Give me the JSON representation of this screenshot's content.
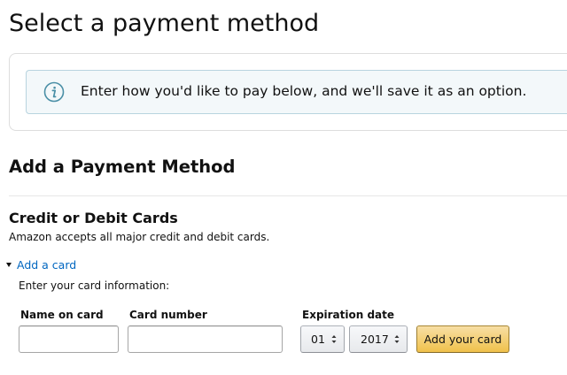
{
  "page": {
    "title": "Select a payment method"
  },
  "alert": {
    "icon": "info-icon",
    "text": "Enter how you'd like to pay below, and we'll save it as an option."
  },
  "section": {
    "heading": "Add a Payment Method"
  },
  "cards": {
    "heading": "Credit or Debit Cards",
    "description": "Amazon accepts all major credit and debit cards.",
    "add_card_label": "Add a card",
    "enter_info": "Enter your card information:"
  },
  "form": {
    "name_label": "Name on card",
    "name_value": "",
    "number_label": "Card number",
    "number_value": "",
    "expiration_label": "Expiration date",
    "month_selected": "01",
    "year_selected": "2017",
    "submit_label": "Add your card"
  },
  "colors": {
    "link": "#0066c0",
    "alert_background": "#f3f8fa",
    "alert_border": "#b8d4df",
    "primary_button": "#f0c14b"
  }
}
